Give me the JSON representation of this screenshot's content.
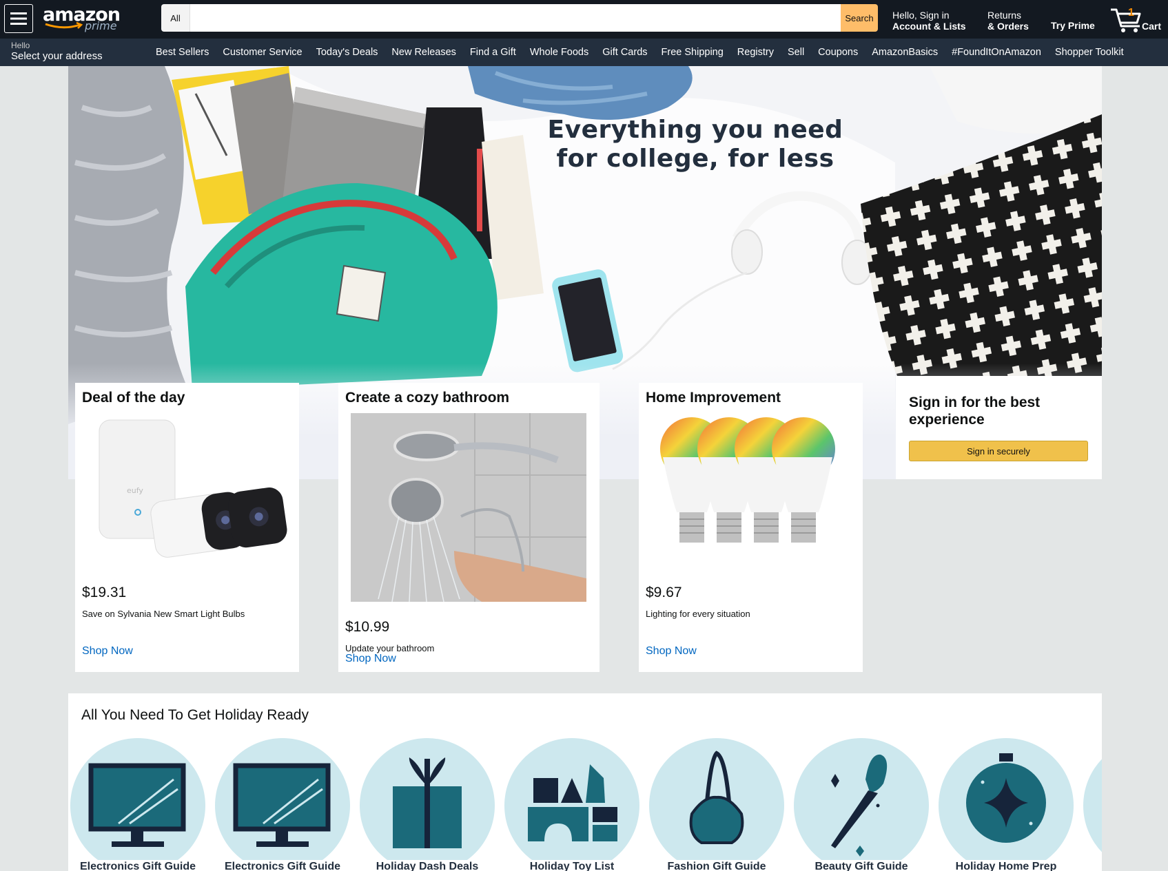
{
  "header": {
    "logo_text": "amazon",
    "logo_sub": "prime",
    "search_category": "All",
    "search_placeholder": "",
    "search_button": "Search",
    "account_line1": "Hello, Sign in",
    "account_line2": "Account & Lists",
    "orders_line1": "Returns",
    "orders_line2": "& Orders",
    "prime_label": "Try Prime",
    "cart_count": "1",
    "cart_label": "Cart"
  },
  "subnav": {
    "hello": "Hello",
    "address": "Select your address",
    "items": [
      "Best Sellers",
      "Customer Service",
      "Today's Deals",
      "New Releases",
      "Find a Gift",
      "Whole Foods",
      "Gift Cards",
      "Free Shipping",
      "Registry",
      "Sell",
      "Coupons",
      "AmazonBasics",
      "#FoundItOnAmazon",
      "Shopper Toolkit"
    ]
  },
  "hero": {
    "line1": "Everything you need",
    "line2": "for college, for less"
  },
  "cards": [
    {
      "title": "Deal of the day",
      "price": "$19.31",
      "desc": "Save on Sylvania New Smart Light Bulbs",
      "link": "Shop Now"
    },
    {
      "title": "Create a cozy bathroom",
      "price": "$10.99",
      "desc": "Update your bathroom",
      "link": "Shop Now"
    },
    {
      "title": "Home Improvement",
      "price": "$9.67",
      "desc": "Lighting for every situation",
      "link": "Shop Now"
    }
  ],
  "signin": {
    "title": "Sign in for the best experience",
    "button": "Sign in securely"
  },
  "holiday": {
    "title": "All You Need To Get Holiday Ready",
    "items": [
      "Electronics Gift Guide",
      "Electronics Gift Guide",
      "Holiday Dash Deals",
      "Holiday Toy List",
      "Fashion Gift Guide",
      "Beauty Gift Guide",
      "Holiday Home Prep"
    ]
  },
  "colors": {
    "nav_bg": "#131921",
    "subnav_bg": "#232f3e",
    "search_button": "#febd69",
    "link": "#0066c0",
    "signin_button": "#f0c14b",
    "holiday_circle": "#cde8ee",
    "holiday_icon": "#1b6a7a"
  }
}
